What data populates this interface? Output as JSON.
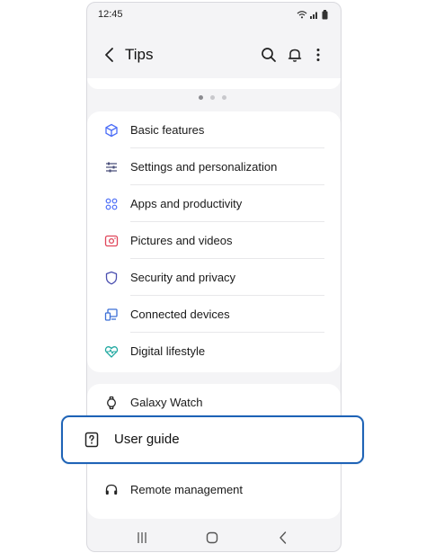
{
  "status_bar": {
    "time": "12:45"
  },
  "app_bar": {
    "title": "Tips"
  },
  "carousel": {
    "pages": 3,
    "active_index": 0
  },
  "categories": [
    {
      "label": "Basic features",
      "icon": "cube-icon",
      "color": "#4a6cf7"
    },
    {
      "label": "Settings and personalization",
      "icon": "sliders-icon",
      "color": "#4a4f7a"
    },
    {
      "label": "Apps and productivity",
      "icon": "apps-grid-icon",
      "color": "#4a6cf7"
    },
    {
      "label": "Pictures and videos",
      "icon": "camera-icon",
      "color": "#e0455a"
    },
    {
      "label": "Security and privacy",
      "icon": "shield-icon",
      "color": "#4a4fb0"
    },
    {
      "label": "Connected devices",
      "icon": "devices-icon",
      "color": "#3c6fd6"
    },
    {
      "label": "Digital lifestyle",
      "icon": "heart-pulse-icon",
      "color": "#1fa8a0"
    }
  ],
  "support": [
    {
      "label": "Galaxy Watch",
      "icon": "watch-icon"
    },
    {
      "label": "User guide",
      "icon": "help-box-icon",
      "highlighted": true
    },
    {
      "label": "Remote management",
      "icon": "headset-icon"
    }
  ],
  "colors": {
    "highlight_border": "#1e63b6",
    "card_bg": "#ffffff",
    "screen_bg": "#f4f4f6"
  }
}
